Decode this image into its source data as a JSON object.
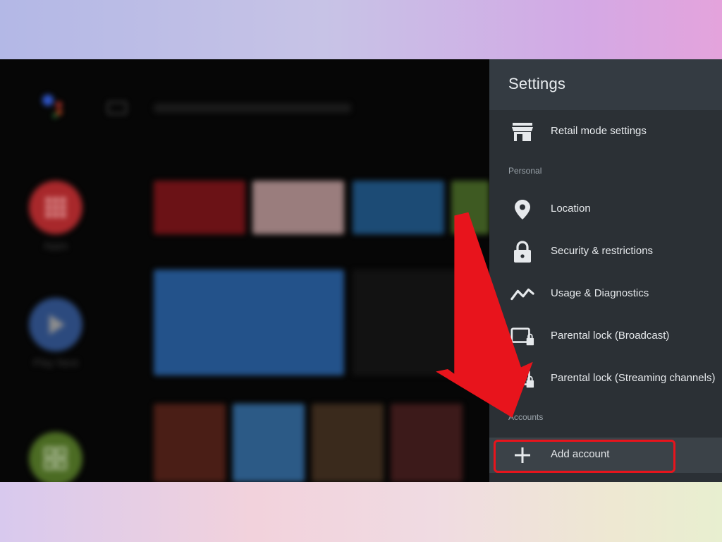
{
  "home": {
    "rail": [
      {
        "label": "Apps",
        "icon": "apps-grid-icon",
        "color": "#a8282b"
      },
      {
        "label": "Play Next",
        "icon": "play-icon",
        "color": "#2c4a7e"
      },
      {
        "label": "",
        "icon": "tiles-icon",
        "color": "#4b6b23"
      }
    ]
  },
  "settings": {
    "title": "Settings",
    "items_top": [
      {
        "label": "Retail mode settings",
        "icon": "store-icon"
      }
    ],
    "section_personal": "Personal",
    "personal_items": [
      {
        "label": "Location",
        "icon": "location-pin-icon"
      },
      {
        "label": "Security & restrictions",
        "icon": "lock-icon"
      },
      {
        "label": "Usage & Diagnostics",
        "icon": "usage-graph-icon"
      },
      {
        "label": "Parental lock (Broadcast)",
        "icon": "tv-lock-icon"
      },
      {
        "label": "Parental lock (Streaming channels)",
        "icon": "tv-lock-icon"
      }
    ],
    "section_accounts": "Accounts",
    "add_account": {
      "label": "Add account",
      "icon": "plus-icon"
    }
  },
  "colors": {
    "panel_bg": "#2b3035",
    "panel_header": "#343b42",
    "annotation_red": "#e8141c"
  }
}
